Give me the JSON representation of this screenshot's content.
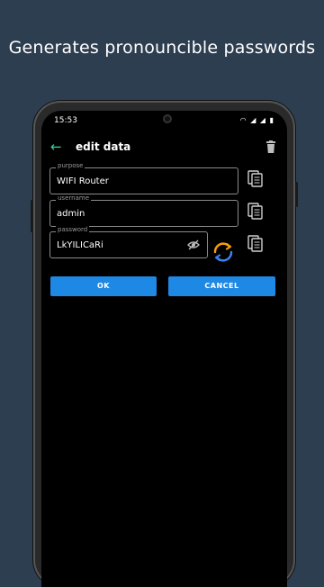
{
  "promo": {
    "headline": "Generates pronouncible passwords"
  },
  "status_bar": {
    "time": "15:53",
    "icons": [
      "wifi-icon",
      "signal-icon",
      "signal-icon",
      "battery-icon"
    ]
  },
  "appbar": {
    "title": "edit data",
    "back_icon": "arrow-back-icon",
    "delete_icon": "trash-icon"
  },
  "form": {
    "purpose": {
      "label": "purpose",
      "value": "WIFI Router"
    },
    "username": {
      "label": "username",
      "value": "admin"
    },
    "password": {
      "label": "password",
      "value": "LkYILICaRi"
    }
  },
  "buttons": {
    "ok": "OK",
    "cancel": "CANCEL"
  },
  "colors": {
    "background": "#2c3e50",
    "accent": "#1e88e5",
    "back_arrow": "#34d399",
    "refresh_orange": "#f59e0b",
    "refresh_blue": "#3b82f6"
  }
}
